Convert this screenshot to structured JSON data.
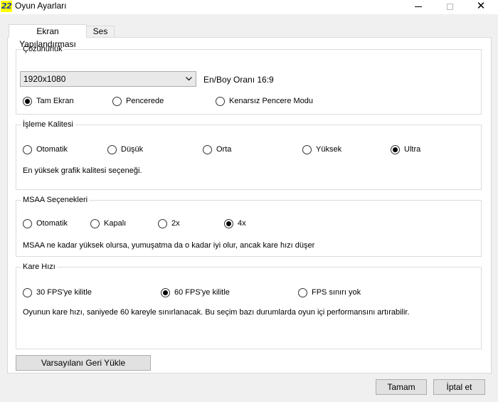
{
  "window": {
    "icon_text": "22",
    "title": "Oyun Ayarları"
  },
  "tabs": [
    {
      "label": "Ekran Yapılandırması",
      "active": true
    },
    {
      "label": "Ses",
      "active": false
    }
  ],
  "resolution": {
    "legend": "Çözünürlük",
    "selected": "1920x1080",
    "aspect_label": "En/Boy Oranı 16:9",
    "modes": [
      {
        "label": "Tam Ekran",
        "checked": true
      },
      {
        "label": "Pencerede",
        "checked": false
      },
      {
        "label": "Kenarsız Pencere Modu",
        "checked": false
      }
    ]
  },
  "render_quality": {
    "legend": "İşleme Kalitesi",
    "options": [
      {
        "label": "Otomatik",
        "checked": false
      },
      {
        "label": "Düşük",
        "checked": false
      },
      {
        "label": "Orta",
        "checked": false
      },
      {
        "label": "Yüksek",
        "checked": false
      },
      {
        "label": "Ultra",
        "checked": true
      }
    ],
    "description": "En yüksek grafik kalitesi seçeneği."
  },
  "msaa": {
    "legend": "MSAA Seçenekleri",
    "options": [
      {
        "label": "Otomatik",
        "checked": false
      },
      {
        "label": "Kapalı",
        "checked": false
      },
      {
        "label": "2x",
        "checked": false
      },
      {
        "label": "4x",
        "checked": true
      }
    ],
    "description": "MSAA ne kadar yüksek olursa, yumuşatma da o kadar iyi olur, ancak kare hızı düşer"
  },
  "frame_rate": {
    "legend": "Kare Hızı",
    "options": [
      {
        "label": "30 FPS'ye kilitle",
        "checked": false
      },
      {
        "label": "60 FPS'ye kilitle",
        "checked": true
      },
      {
        "label": "FPS sınırı yok",
        "checked": false
      }
    ],
    "description": "Oyunun kare hızı, saniyede 60 kareyle sınırlanacak. Bu seçim bazı durumlarda oyun içi performansını artırabilir."
  },
  "buttons": {
    "reset": "Varsayılanı Geri Yükle",
    "ok": "Tamam",
    "cancel": "İptal et"
  }
}
